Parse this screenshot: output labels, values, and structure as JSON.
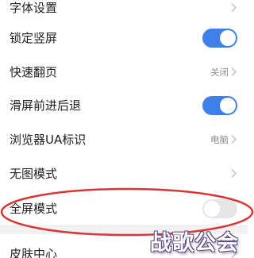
{
  "settings": {
    "items": [
      {
        "label": "字体设置",
        "control": "chevron"
      },
      {
        "label": "锁定竖屏",
        "control": "toggle",
        "on": true
      },
      {
        "label": "快速翻页",
        "control": "value",
        "value": "关闭"
      },
      {
        "label": "滑屏前进后退",
        "control": "toggle",
        "on": true
      },
      {
        "label": "浏览器UA标识",
        "control": "value",
        "value": "电脑"
      },
      {
        "label": "无图模式",
        "control": "chevron"
      },
      {
        "label": "全屏模式",
        "control": "toggle",
        "on": false
      },
      {
        "label": "皮肤中心",
        "control": "chevron"
      }
    ]
  },
  "annotation": {
    "shape": "ellipse",
    "color": "#d93636",
    "target": "全屏模式"
  },
  "watermark": {
    "text": "战歌公会"
  },
  "colors": {
    "accent": "#3f7fe8",
    "toggle_off": "#e6e6e6",
    "secondary_text": "#8e8e8e",
    "annotation": "#d93636"
  },
  "icons": {
    "chevron": "chevron-right-icon"
  }
}
